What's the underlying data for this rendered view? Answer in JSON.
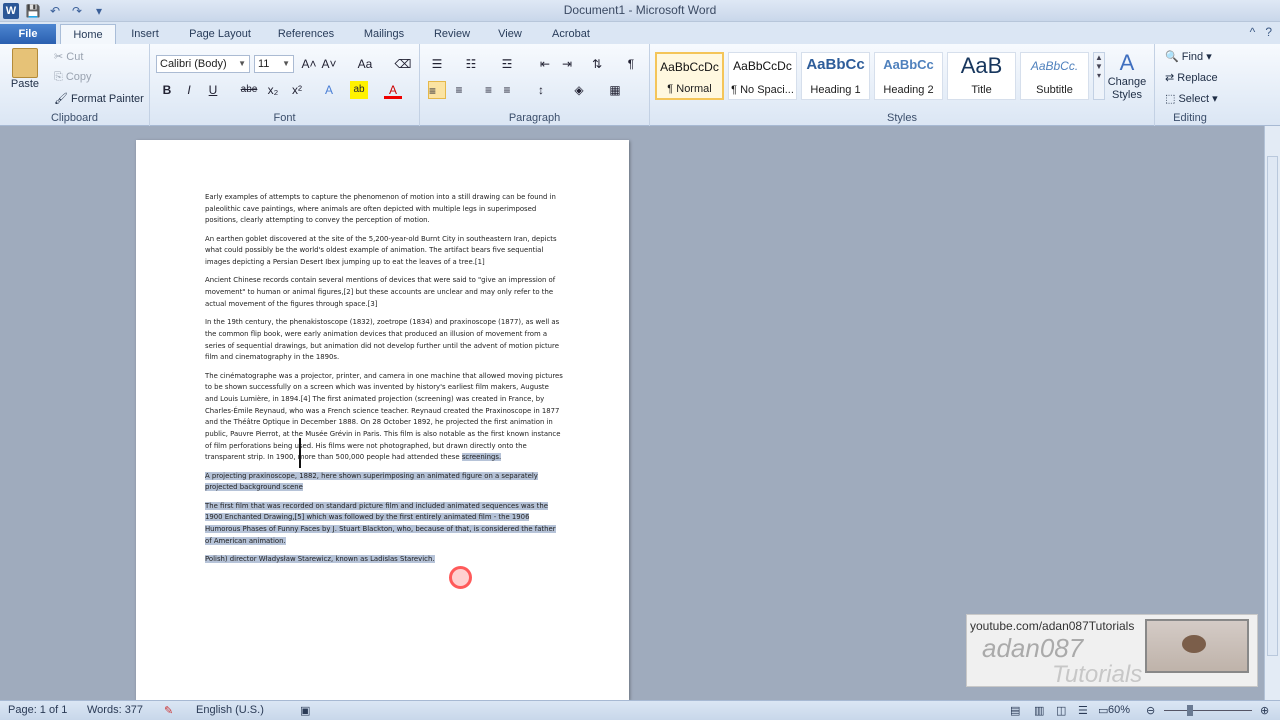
{
  "window": {
    "title": "Document1 - Microsoft Word",
    "app_icon": "W"
  },
  "quick_access": {
    "save": "💾",
    "undo": "↶",
    "redo": "↷",
    "more": "▾"
  },
  "tabs": [
    "File",
    "Home",
    "Insert",
    "Page Layout",
    "References",
    "Mailings",
    "Review",
    "View",
    "Acrobat"
  ],
  "ribbon": {
    "clipboard": {
      "paste": "Paste",
      "cut": "Cut",
      "copy": "Copy",
      "format_painter": "Format Painter",
      "label": "Clipboard"
    },
    "font": {
      "font_name": "Calibri (Body)",
      "font_size": "11",
      "label": "Font",
      "bold": "B",
      "italic": "I",
      "underline": "U",
      "strike": "abe",
      "sub": "x₂",
      "sup": "x²",
      "grow": "A˄",
      "shrink": "A˅",
      "case": "Aa",
      "effects": "A",
      "highlight": "ab",
      "color": "A"
    },
    "paragraph": {
      "label": "Paragraph",
      "bullets": "☰",
      "numbering": "☷",
      "multilevel": "☲",
      "decrease": "⇤",
      "increase": "⇥",
      "sort": "⇅",
      "show": "¶",
      "align_left": "≡",
      "center": "≡",
      "right": "≡",
      "justify": "≡",
      "line_spacing": "↕",
      "shading": "◈",
      "borders": "▦"
    },
    "styles": {
      "label": "Styles",
      "items": [
        {
          "sample": "AaBbCcDc",
          "name": "¶ Normal"
        },
        {
          "sample": "AaBbCcDc",
          "name": "¶ No Spaci..."
        },
        {
          "sample": "AaBbCc",
          "name": "Heading 1"
        },
        {
          "sample": "AaBbCc",
          "name": "Heading 2"
        },
        {
          "sample": "AaB",
          "name": "Title"
        },
        {
          "sample": "AaBbCc.",
          "name": "Subtitle"
        }
      ],
      "change_styles": "Change Styles"
    },
    "editing": {
      "label": "Editing",
      "find": "Find",
      "replace": "Replace",
      "select": "Select"
    }
  },
  "document": {
    "paragraphs": [
      "Early examples of attempts to capture the phenomenon of motion into a still drawing can be found in paleolithic cave paintings, where animals are often depicted with multiple legs in superimposed positions, clearly attempting to convey the perception of motion.",
      "An earthen goblet discovered at the site of the 5,200-year-old Burnt City in southeastern Iran, depicts what could possibly be the world's oldest example of animation. The artifact bears five sequential images depicting a Persian Desert Ibex jumping up to eat the leaves of a tree.[1]",
      "Ancient Chinese records contain several mentions of devices that were said to \"give an impression of movement\" to human or animal figures,[2] but these accounts are unclear and may only refer to the actual movement of the figures through space.[3]",
      "In the 19th century, the phenakistoscope (1832), zoetrope (1834) and praxinoscope (1877), as well as the common flip book, were early animation devices that produced an illusion of movement from a series of sequential drawings, but animation did not develop further until the advent of motion picture film and cinematography in the 1890s."
    ],
    "para5_main": "The cinématographe was a projector, printer, and camera in one machine that allowed moving pictures to be shown successfully on a screen which was invented by history's earliest film makers, Auguste and Louis Lumière, in 1894.[4] The first animated projection (screening) was created in France, by Charles-Émile Reynaud, who was a French science teacher. Reynaud created the Praxinoscope in 1877 and the Théâtre Optique in December 1888. On 28 October 1892, he projected the first animation in public, Pauvre Pierrot, at the Musée Grévin in Paris. This film is also notable as the first known instance of film perforations being used. His films were not photographed, but drawn directly onto the transparent strip. In 1900, more than 500,000 people had attended these ",
    "para5_selected": "screenings.",
    "selected_paragraphs": [
      "A projecting praxinoscope, 1882, here shown superimposing an animated figure on a separately projected background scene",
      "The first film that was recorded on standard picture film and included animated sequences was the 1900 Enchanted Drawing,[5] which was followed by the first entirely animated film - the 1906 Humorous Phases of Funny Faces by J. Stuart Blackton, who, because of that, is considered the father of American animation.",
      "Polish) director Władysław Starewicz, known as Ladislas Starevich."
    ]
  },
  "watermark": {
    "url": "youtube.com/adan087Tutorials",
    "name": "adan087",
    "tagline": "Tutorials"
  },
  "status_bar": {
    "page": "Page: 1 of 1",
    "words": "Words: 377",
    "language": "English (U.S.)",
    "zoom": "60%"
  }
}
